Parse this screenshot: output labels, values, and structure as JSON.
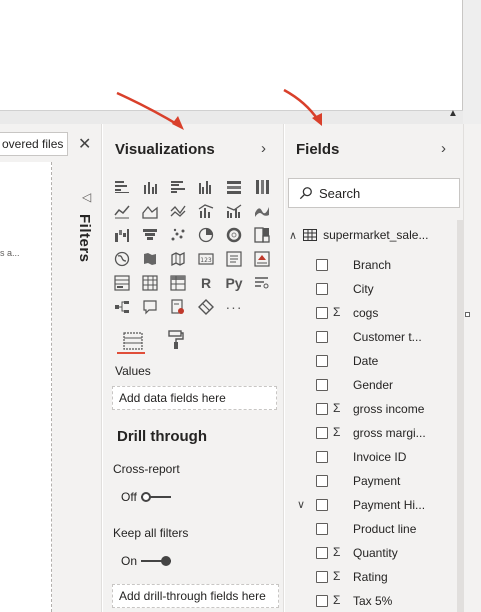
{
  "left_pane": {
    "search_text": "overed files",
    "snippet": "s a...",
    "filters_label": "Filters"
  },
  "visualizations": {
    "title": "Visualizations",
    "values_label": "Values",
    "values_placeholder": "Add data fields here",
    "drill_title": "Drill through",
    "cross_report_label": "Cross-report",
    "cross_report_state": "Off",
    "keep_filters_label": "Keep all filters",
    "keep_filters_state": "On",
    "drill_placeholder": "Add drill-through fields here",
    "icon_text": {
      "r": "R",
      "py": "Py",
      "more": "···"
    }
  },
  "fields": {
    "title": "Fields",
    "search_placeholder": "Search",
    "table_name": "supermarket_sale...",
    "items": [
      {
        "name": "Branch",
        "sigma": false,
        "expand": false
      },
      {
        "name": "City",
        "sigma": false,
        "expand": false
      },
      {
        "name": "cogs",
        "sigma": true,
        "expand": false
      },
      {
        "name": "Customer t...",
        "sigma": false,
        "expand": false
      },
      {
        "name": "Date",
        "sigma": false,
        "expand": false
      },
      {
        "name": "Gender",
        "sigma": false,
        "expand": false
      },
      {
        "name": "gross income",
        "sigma": true,
        "expand": false
      },
      {
        "name": "gross margi...",
        "sigma": true,
        "expand": false
      },
      {
        "name": "Invoice ID",
        "sigma": false,
        "expand": false
      },
      {
        "name": "Payment",
        "sigma": false,
        "expand": false
      },
      {
        "name": "Payment Hi...",
        "sigma": false,
        "expand": true
      },
      {
        "name": "Product line",
        "sigma": false,
        "expand": false
      },
      {
        "name": "Quantity",
        "sigma": true,
        "expand": false
      },
      {
        "name": "Rating",
        "sigma": true,
        "expand": false
      },
      {
        "name": "Tax 5%",
        "sigma": true,
        "expand": false
      }
    ]
  },
  "colors": {
    "arrow": "#d9402b",
    "underline": "#e04e39",
    "pane_bg": "#f3f2f1"
  }
}
